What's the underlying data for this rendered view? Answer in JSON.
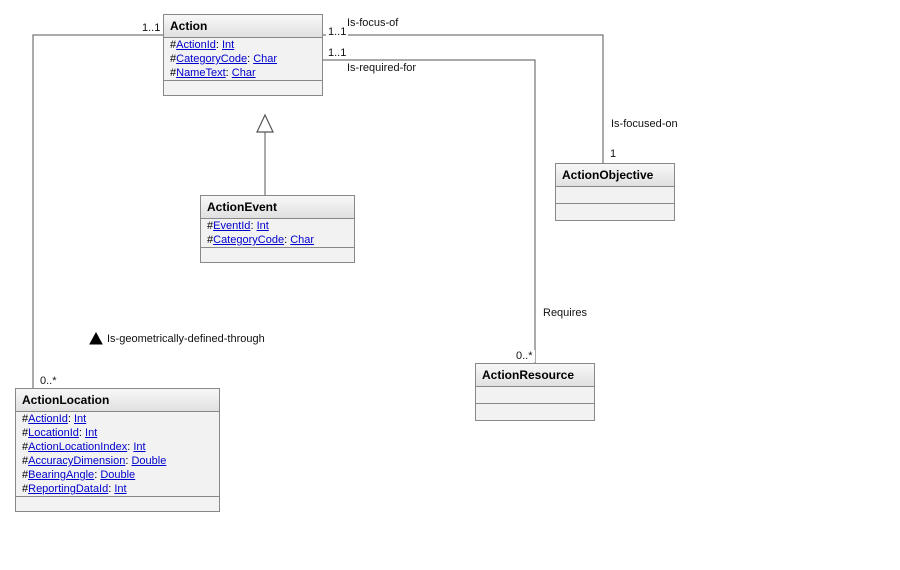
{
  "classes": {
    "action": {
      "name": "Action",
      "attrs": [
        {
          "vis": "#",
          "name": "ActionId",
          "type": "Int"
        },
        {
          "vis": "#",
          "name": "CategoryCode",
          "type": "Char"
        },
        {
          "vis": "#",
          "name": "NameText",
          "type": "Char"
        }
      ]
    },
    "actionEvent": {
      "name": "ActionEvent",
      "attrs": [
        {
          "vis": "#",
          "name": "EventId",
          "type": "Int"
        },
        {
          "vis": "#",
          "name": "CategoryCode",
          "type": "Char"
        }
      ]
    },
    "actionObjective": {
      "name": "ActionObjective",
      "attrs": []
    },
    "actionResource": {
      "name": "ActionResource",
      "attrs": []
    },
    "actionLocation": {
      "name": "ActionLocation",
      "attrs": [
        {
          "vis": "#",
          "name": "ActionId",
          "type": "Int"
        },
        {
          "vis": "#",
          "name": "LocationId",
          "type": "Int"
        },
        {
          "vis": "#",
          "name": "ActionLocationIndex",
          "type": "Int"
        },
        {
          "vis": "#",
          "name": "AccuracyDimension",
          "type": "Double"
        },
        {
          "vis": "#",
          "name": "BearingAngle",
          "type": "Double"
        },
        {
          "vis": "#",
          "name": "ReportingDataId",
          "type": "Int"
        }
      ]
    }
  },
  "labels": {
    "isFocusOf": "Is-focus-of",
    "isFocusedOn": "Is-focused-on",
    "isRequiredFor": "Is-required-for",
    "requires": "Requires",
    "isGeoDef": "Is-geometrically-defined-through",
    "m11a": "1..1",
    "m11b": "1..1",
    "m11c": "1..1",
    "m1": "1",
    "m0star_a": "0..*",
    "m0star_b": "0..*"
  },
  "chart_data": {
    "type": "diagram",
    "notation": "UML class diagram",
    "classes": [
      {
        "name": "Action",
        "attributes": [
          "#ActionId: Int",
          "#CategoryCode: Char",
          "#NameText: Char"
        ]
      },
      {
        "name": "ActionEvent",
        "attributes": [
          "#EventId: Int",
          "#CategoryCode: Char"
        ]
      },
      {
        "name": "ActionObjective",
        "attributes": []
      },
      {
        "name": "ActionResource",
        "attributes": []
      },
      {
        "name": "ActionLocation",
        "attributes": [
          "#ActionId: Int",
          "#LocationId: Int",
          "#ActionLocationIndex: Int",
          "#AccuracyDimension: Double",
          "#BearingAngle: Double",
          "#ReportingDataId: Int"
        ]
      }
    ],
    "relationships": [
      {
        "from": "ActionEvent",
        "to": "Action",
        "type": "generalization"
      },
      {
        "from": "Action",
        "to": "ActionObjective",
        "type": "association",
        "name": "Is-focus-of / Is-focused-on",
        "fromMult": "1..1",
        "toMult": "1"
      },
      {
        "from": "Action",
        "to": "ActionResource",
        "type": "association",
        "name": "Is-required-for / Requires",
        "fromMult": "1..1",
        "toMult": "0..*"
      },
      {
        "from": "Action",
        "to": "ActionLocation",
        "type": "association",
        "name": "Is-geometrically-defined-through",
        "fromMult": "1..1",
        "toMult": "0..*"
      }
    ]
  }
}
